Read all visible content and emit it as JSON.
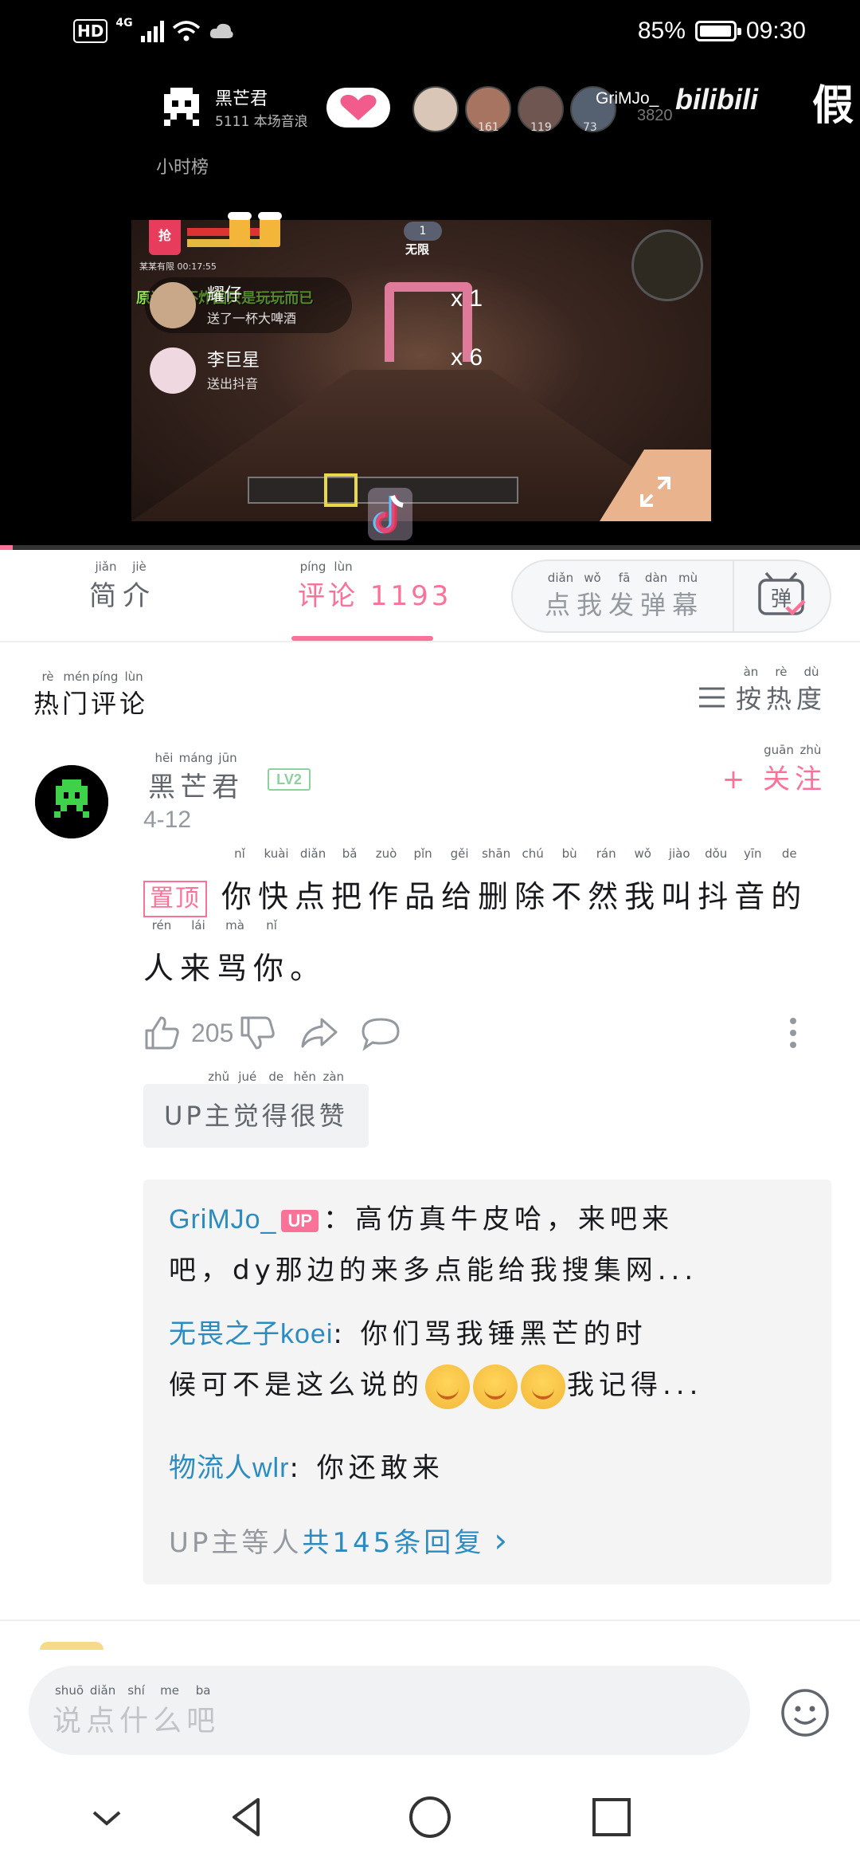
{
  "status_bar": {
    "hd": "HD",
    "network": "4G",
    "battery_text": "85%",
    "battery_level": 0.85,
    "time": "09:30"
  },
  "video": {
    "streamer_name": "黑芒君",
    "streamer_sub": "5111 本场音浪",
    "viewers": [
      "161",
      "119",
      "73"
    ],
    "bili_user": "GriMJo_",
    "bili_logo": "bilibili",
    "bili_sub": "3820",
    "overflow_text": "假",
    "hour_rank": "小时榜",
    "hud_badge": "抢",
    "hud_time": "某某有限 00:17:55",
    "hud_top_num": "1",
    "hud_mode": "无限",
    "hud_message": "原谅！ 不炸图只是玩玩而已",
    "gift1_name": "耀仔",
    "gift1_desc": "送了一杯大啤酒",
    "gift1_count": "x 1",
    "gift2_name": "李巨星",
    "gift2_desc": "送出抖音",
    "gift2_count": "x 6",
    "progress": 0.015
  },
  "tabs": {
    "intro": "简介",
    "intro_py": [
      "jiǎn",
      "jiè"
    ],
    "comments": "评论 1193",
    "comments_py": [
      "píng",
      "lùn"
    ],
    "danmaku": "点我发弹幕",
    "danmaku_py": [
      "diǎn",
      "wǒ",
      "fā",
      "dàn",
      "mù"
    ],
    "danmaku_btn": "弹"
  },
  "comments_section": {
    "title": "热门评论",
    "title_py": [
      "rè",
      "mén",
      "píng",
      "lùn"
    ],
    "sort": "按热度",
    "sort_py": [
      "àn",
      "rè",
      "dù"
    ]
  },
  "comment": {
    "author": "黑芒君",
    "author_py": [
      "hēi",
      "máng",
      "jūn"
    ],
    "level": "LV2",
    "follow": "+ 关注",
    "follow_py": [
      "guān",
      "zhù"
    ],
    "date": "4-12",
    "pin": "置顶",
    "text": "你快点把作品给删除不然我叫抖音的人来骂你。",
    "text_py": [
      "nǐ",
      "kuài",
      "diǎn",
      "bǎ",
      "zuò",
      "pǐn",
      "gěi",
      "shān",
      "chú",
      "bù",
      "rán",
      "wǒ",
      "jiào",
      "dǒu",
      "yīn",
      "de",
      "rén",
      "lái",
      "mà",
      "nǐ",
      ""
    ],
    "likes": "205",
    "up_liked": "UP主觉得很赞",
    "up_liked_py": [
      "",
      "",
      "zhǔ",
      "jué",
      "de",
      "hěn",
      "zàn"
    ]
  },
  "replies": [
    {
      "author": "GriMJo_",
      "is_up": true,
      "up_tag": "UP",
      "text_line1": "：高仿真牛皮哈，来吧来",
      "text_line2": "吧，dy那边的来多点能给我搜集网..."
    },
    {
      "author": "无畏之子koei",
      "text_line1": ": 你们骂我锤黑芒的时",
      "text_line2": "候可不是这么说的",
      "text_tail": "我记得..."
    },
    {
      "author": "物流人wlr",
      "text_line1": ": 你还敢来"
    }
  ],
  "reply_more": {
    "prefix": "UP主等人",
    "link": "共145条回复",
    "arrow": "›"
  },
  "input": {
    "placeholder": "说点什么吧",
    "placeholder_py": [
      "shuō",
      "diǎn",
      "shí",
      "me",
      "ba"
    ]
  },
  "colors": {
    "accent": "#fb7299",
    "link": "#2c8cc1",
    "muted": "#9499a0"
  }
}
